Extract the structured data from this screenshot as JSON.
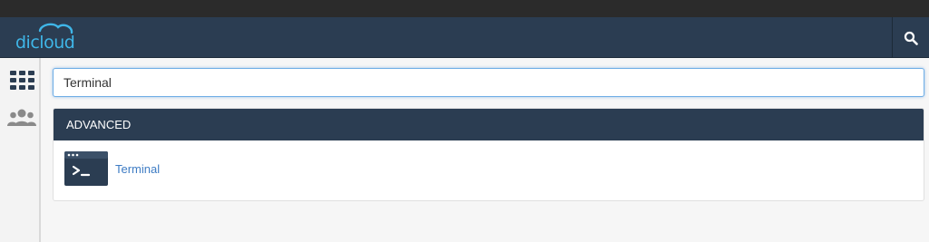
{
  "header": {
    "logo_text": "dicloud",
    "search_icon": "search-icon"
  },
  "sidebar": {
    "items": [
      {
        "name": "apps",
        "icon": "grid-icon"
      },
      {
        "name": "users",
        "icon": "users-icon"
      }
    ]
  },
  "search": {
    "value": "Terminal"
  },
  "results": {
    "section_title": "ADVANCED",
    "items": [
      {
        "label": "Terminal",
        "icon": "terminal-icon"
      }
    ]
  },
  "colors": {
    "header_bg": "#2b3d52",
    "logo_accent": "#3fb6e8",
    "link": "#3e7cc4",
    "focus_border": "#6faee6"
  }
}
